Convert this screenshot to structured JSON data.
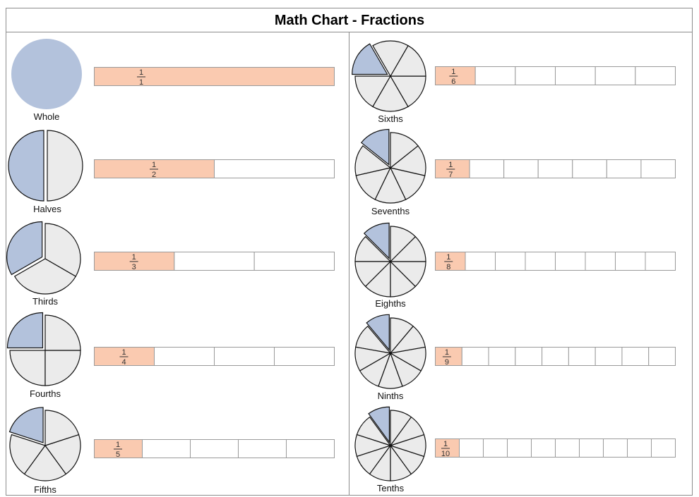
{
  "title": "Math Chart - Fractions",
  "colors": {
    "highlight_slice": "#b3c2dc",
    "other_slice": "#ebebeb",
    "slice_stroke": "#111111",
    "highlight_bar": "#facab0",
    "empty_bar": "#ffffff",
    "bar_border": "#9a9a9a",
    "frame": "#8c8c8c"
  },
  "chart_data": {
    "type": "pie",
    "title": "Math Chart - Fractions",
    "fractions": [
      {
        "name": "Whole",
        "denominator": 1,
        "highlighted": 1,
        "label": {
          "num": "1",
          "den": "1"
        }
      },
      {
        "name": "Halves",
        "denominator": 2,
        "highlighted": 1,
        "label": {
          "num": "1",
          "den": "2"
        }
      },
      {
        "name": "Thirds",
        "denominator": 3,
        "highlighted": 1,
        "label": {
          "num": "1",
          "den": "3"
        }
      },
      {
        "name": "Fourths",
        "denominator": 4,
        "highlighted": 1,
        "label": {
          "num": "1",
          "den": "4"
        }
      },
      {
        "name": "Fifths",
        "denominator": 5,
        "highlighted": 1,
        "label": {
          "num": "1",
          "den": "5"
        }
      },
      {
        "name": "Sixths",
        "denominator": 6,
        "highlighted": 1,
        "label": {
          "num": "1",
          "den": "6"
        }
      },
      {
        "name": "Sevenths",
        "denominator": 7,
        "highlighted": 1,
        "label": {
          "num": "1",
          "den": "7"
        }
      },
      {
        "name": "Eighths",
        "denominator": 8,
        "highlighted": 1,
        "label": {
          "num": "1",
          "den": "8"
        }
      },
      {
        "name": "Ninths",
        "denominator": 9,
        "highlighted": 1,
        "label": {
          "num": "1",
          "den": "9"
        }
      },
      {
        "name": "Tenths",
        "denominator": 10,
        "highlighted": 1,
        "label": {
          "num": "1",
          "den": "10"
        }
      }
    ]
  }
}
